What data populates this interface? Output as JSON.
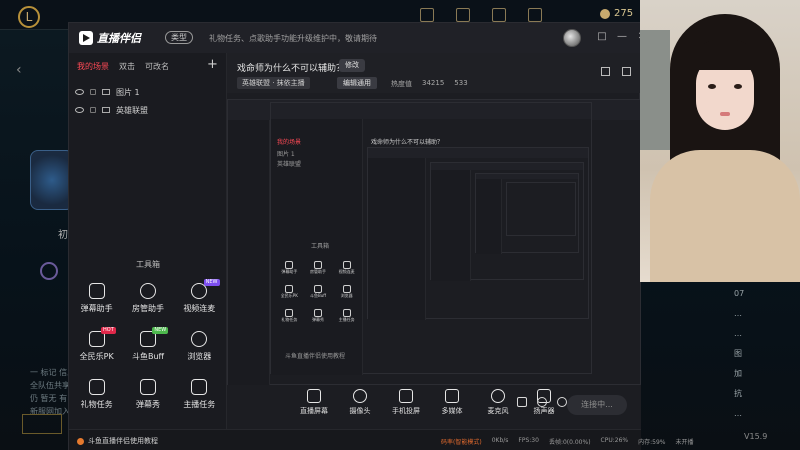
{
  "background_client": {
    "currency": "275",
    "label_truncated": "初",
    "chat_lines": [
      "一 标记 信息",
      "全队伍共享 等待",
      "仍 暂无 有",
      "新服网加入"
    ],
    "right_chat": [
      "07",
      "…",
      "…",
      "图",
      "加",
      "抗",
      "…"
    ],
    "version": "V15.9"
  },
  "app": {
    "logo_text": "直播伴侣",
    "header_badge": "类型",
    "header_marquee": "礼物任务、点歌助手功能升级维护中，敬请期待",
    "window_controls": [
      "□",
      "—",
      "✕"
    ]
  },
  "sidebar": {
    "tabs": [
      {
        "label": "我的场景",
        "active": true
      },
      {
        "label": "双击",
        "active": false
      },
      {
        "label": "可改名",
        "active": false
      }
    ],
    "add_label": "+",
    "scenes": [
      {
        "label": "图片 1"
      },
      {
        "label": "英雄联盟"
      }
    ],
    "toolbox_title": "工具箱",
    "tools": [
      {
        "label": "弹幕助手",
        "icon": "chat-icon",
        "tag": ""
      },
      {
        "label": "房管助手",
        "icon": "user-icon",
        "tag": ""
      },
      {
        "label": "视频连麦",
        "icon": "video-link-icon",
        "tag": "NEW"
      },
      {
        "label": "全民乐PK",
        "icon": "pk-icon",
        "tag": "HOT"
      },
      {
        "label": "斗鱼Buff",
        "icon": "buff-icon",
        "tag": "NEW"
      },
      {
        "label": "浏览器",
        "icon": "browser-icon",
        "tag": ""
      },
      {
        "label": "礼物任务",
        "icon": "gift-icon",
        "tag": ""
      },
      {
        "label": "弹幕秀",
        "icon": "danmaku-show-icon",
        "tag": ""
      },
      {
        "label": "主播任务",
        "icon": "task-icon",
        "tag": ""
      }
    ]
  },
  "topic": {
    "title": "戏命师为什么不可以辅助？",
    "edit_label": "修改",
    "category": "英雄联盟 · 抹依主播",
    "vibe_label": "编辑通用",
    "stat_label": "热度值",
    "stat_value": "34215",
    "fans_value": "533"
  },
  "bottom_bar": {
    "items": [
      {
        "label": "直播屏幕",
        "icon": "screen-icon"
      },
      {
        "label": "摄像头",
        "icon": "camera-icon"
      },
      {
        "label": "手机投屏",
        "icon": "phone-icon"
      },
      {
        "label": "多媒体",
        "icon": "media-icon"
      },
      {
        "label": "麦克风",
        "icon": "mic-icon"
      },
      {
        "label": "扬声器",
        "icon": "speaker-icon"
      }
    ],
    "live_button": "连接中..."
  },
  "status_bar": {
    "notice": "斗鱼直播伴侣使用教程",
    "mode": "码率(智能模式)",
    "bitrate": "0Kb/s",
    "fps": "FPS:30",
    "drop": "丢帧:0(0.00%)",
    "cpu": "CPU:26%",
    "memory": "内存:59%",
    "recording": "未开播"
  },
  "colors": {
    "accent": "#ff4a56",
    "tag_hot": "#e0284a",
    "tag_new": "#7d4ff0",
    "status_warning": "#e06a2e"
  }
}
